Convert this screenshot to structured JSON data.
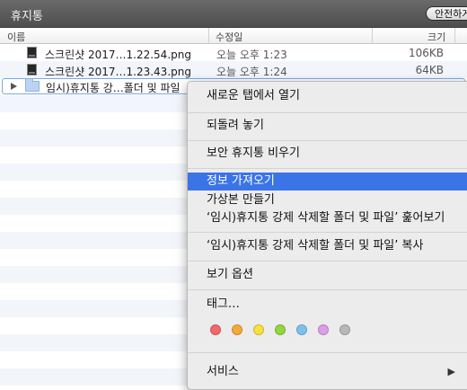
{
  "window": {
    "title": "휴지통",
    "secure_button": "안전하게 비우기"
  },
  "columns": {
    "name": "이름",
    "modified": "수정일",
    "size": "크기"
  },
  "files": [
    {
      "name": "스크린샷 2017…1.22.54.png",
      "date": "오늘 오후 1:23",
      "size": "106KB"
    },
    {
      "name": "스크린샷 2017…1.23.43.png",
      "date": "오늘 오후 1:24",
      "size": "64KB"
    }
  ],
  "folder": {
    "name": "임시)휴지통 강…폴더 및 파일"
  },
  "context_menu": {
    "open_new_tab": "새로운 탭에서 열기",
    "put_back": "되돌려 놓기",
    "secure_empty": "보안 휴지통 비우기",
    "get_info": "정보 가져오기",
    "make_alias": "가상본 만들기",
    "quick_look": "‘임시)휴지통 강제 삭제할 폴더 및 파일’ 훑어보기",
    "copy": "‘임시)휴지통 강제 삭제할 폴더 및 파일’ 복사",
    "view_options": "보기 옵션",
    "tags": "태그…",
    "services": "서비스"
  },
  "tag_colors": [
    "#f0696b",
    "#f6a93b",
    "#f7e13c",
    "#93d63e",
    "#7cc1ee",
    "#dc9ee8",
    "#b8b8b8"
  ],
  "colors": {
    "highlight": "#3b74e6",
    "titlebar": "#5a5a5a"
  }
}
